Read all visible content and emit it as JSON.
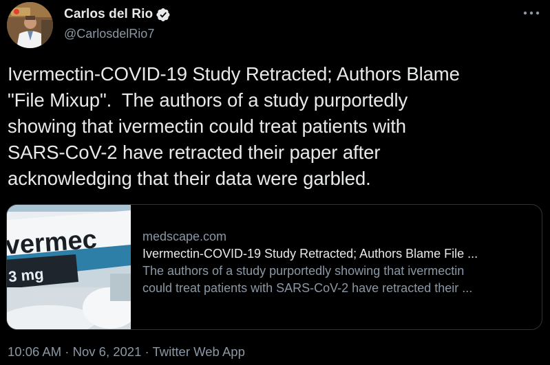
{
  "author": {
    "display_name": "Carlos del Rio",
    "handle": "@CarlosdelRio7",
    "verified": true,
    "avatar_icon": "profile-photo"
  },
  "tweet": {
    "text": "Ivermectin-COVID-19 Study Retracted; Authors Blame\n\"File Mixup\".  The authors of a study purportedly\nshowing that ivermectin could treat patients with\nSARS-CoV-2 have retracted their paper after\nacknowledging that their data were garbled."
  },
  "link_card": {
    "domain": "medscape.com",
    "title": "Ivermectin-COVID-19 Study Retracted; Authors Blame File ...",
    "description_line1": "The authors of a study purportedly showing that ivermectin",
    "description_line2": "could treat patients with SARS-CoV-2 have retracted their ...",
    "thumbnail_text": "vermec",
    "thumbnail_dose": "3 mg"
  },
  "meta": {
    "time": "10:06 AM",
    "separator1": " · ",
    "date": "Nov 6, 2021",
    "separator2": " · ",
    "source": "Twitter Web App"
  },
  "colors": {
    "background": "#000000",
    "text_primary": "#e7e9ea",
    "text_secondary": "#8b98a5",
    "verified_badge": "#e7e9ea",
    "card_border": "#2f3336"
  }
}
